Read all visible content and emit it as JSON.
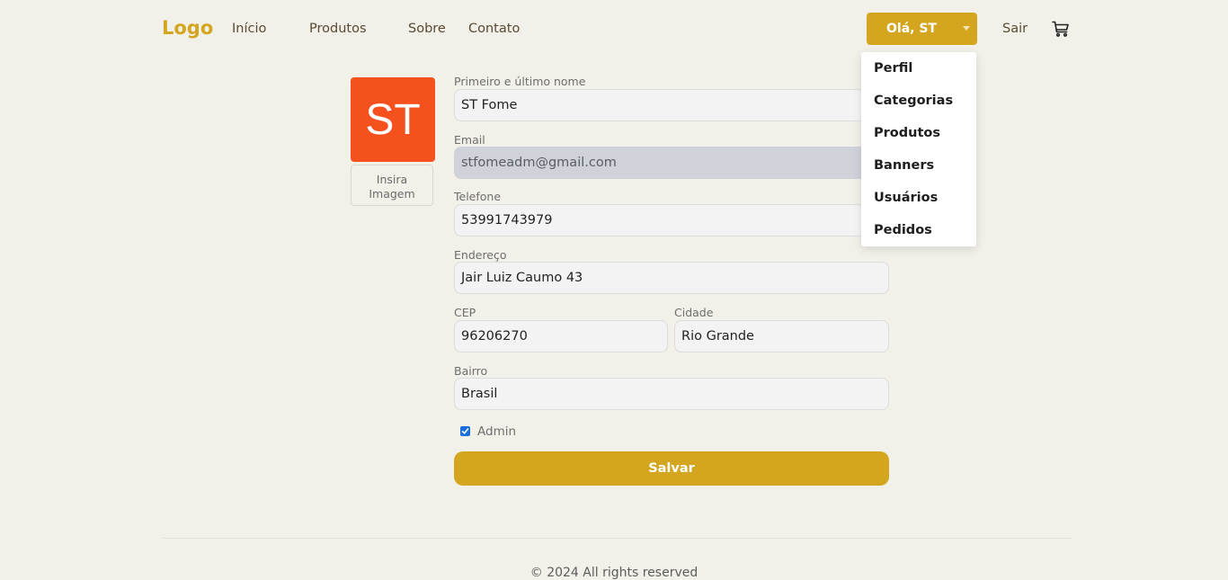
{
  "header": {
    "logo": "Logo",
    "nav": [
      "Início",
      "Produtos",
      "Sobre",
      "Contato"
    ],
    "greeting": "Olá, ST",
    "logout": "Sair",
    "cart_icon": "cart-icon"
  },
  "dropdown": {
    "items": [
      "Perfil",
      "Categorias",
      "Produtos",
      "Banners",
      "Usuários",
      "Pedidos"
    ]
  },
  "profile": {
    "avatar_initials": "ST",
    "avatar_color": "#f4511e",
    "image_button": "Insira Imagem"
  },
  "form": {
    "name": {
      "label": "Primeiro e último nome",
      "value": "ST Fome"
    },
    "email": {
      "label": "Email",
      "value": "stfomeadm@gmail.com"
    },
    "phone": {
      "label": "Telefone",
      "value": "53991743979"
    },
    "address": {
      "label": "Endereço",
      "value": "Jair Luiz Caumo 43"
    },
    "cep": {
      "label": "CEP",
      "value": "96206270"
    },
    "city": {
      "label": "Cidade",
      "value": "Rio Grande"
    },
    "district": {
      "label": "Bairro",
      "value": "Brasil"
    },
    "admin": {
      "label": "Admin",
      "checked": true
    },
    "save": "Salvar"
  },
  "footer": {
    "text": "© 2024 All rights reserved"
  },
  "colors": {
    "accent": "#d4a51f",
    "background": "#f1f0e9"
  }
}
